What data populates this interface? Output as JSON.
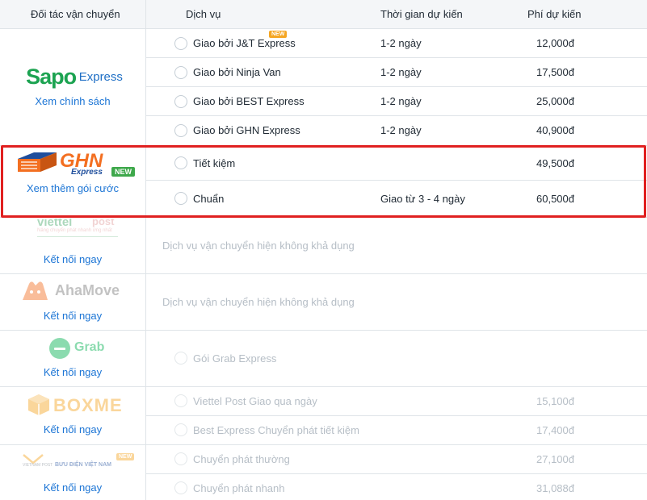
{
  "header": {
    "partner": "Đối tác vận chuyển",
    "service": "Dịch vụ",
    "eta": "Thời gian dự kiến",
    "fee": "Phí dự kiến"
  },
  "partners": {
    "sapo": {
      "logo_main": "Sapo",
      "logo_sub": "Express",
      "link": "Xem chính sách",
      "services": [
        {
          "name": "Giao bởi J&T Express",
          "eta": "1-2 ngày",
          "fee": "12,000đ",
          "badge": "NEW"
        },
        {
          "name": "Giao bởi Ninja Van",
          "eta": "1-2 ngày",
          "fee": "17,500đ"
        },
        {
          "name": "Giao bởi BEST Express",
          "eta": "1-2 ngày",
          "fee": "25,000đ"
        },
        {
          "name": "Giao bởi GHN Express",
          "eta": "1-2 ngày",
          "fee": "40,900đ"
        }
      ]
    },
    "ghn": {
      "logo_main": "GHN",
      "logo_sub": "Express",
      "badge": "NEW",
      "link": "Xem thêm gói cước",
      "services": [
        {
          "name": "Tiết kiệm",
          "eta": "",
          "fee": "49,500đ"
        },
        {
          "name": "Chuẩn",
          "eta": "Giao từ 3 - 4 ngày",
          "fee": "60,500đ"
        }
      ]
    },
    "viettel": {
      "logo_main": "viettel",
      "logo_sub": "post",
      "logo_tagline": "Nâng chuyển phát nhanh ứng nhất",
      "link": "Kết nối ngay",
      "unavailable": "Dịch vụ vận chuyển hiện không khả dụng"
    },
    "ahamove": {
      "logo_main": "AhaMove",
      "link": "Kết nối ngay",
      "unavailable": "Dịch vụ vận chuyển hiện không khả dụng"
    },
    "grab": {
      "logo_main": "Grab",
      "link": "Kết nối ngay",
      "services": [
        {
          "name": "Gói Grab Express",
          "eta": "",
          "fee": ""
        }
      ]
    },
    "boxme": {
      "logo_main": "BOXME",
      "link": "Kết nối ngay",
      "services": [
        {
          "name": "Viettel Post Giao qua ngày",
          "eta": "",
          "fee": "15,100đ"
        },
        {
          "name": "Best Express Chuyển phát tiết kiệm",
          "eta": "",
          "fee": "17,400đ"
        }
      ]
    },
    "vnpost": {
      "logo_small": "VIETNAM POST",
      "logo_main": "BƯU ĐIỆN VIỆT NAM",
      "badge": "NEW",
      "link": "Kết nối ngay",
      "services": [
        {
          "name": "Chuyển phát thường",
          "eta": "",
          "fee": "27,100đ"
        },
        {
          "name": "Chuyển phát nhanh",
          "eta": "",
          "fee": "31,088đ"
        }
      ]
    }
  },
  "colors": {
    "link": "#1c75d5",
    "highlight": "#e02020",
    "sapo_green": "#1ca351",
    "ghn_orange": "#f36f21",
    "ghn_blue": "#1f4e9c",
    "new_green": "#3ea84b",
    "new_orange": "#f5a623"
  }
}
